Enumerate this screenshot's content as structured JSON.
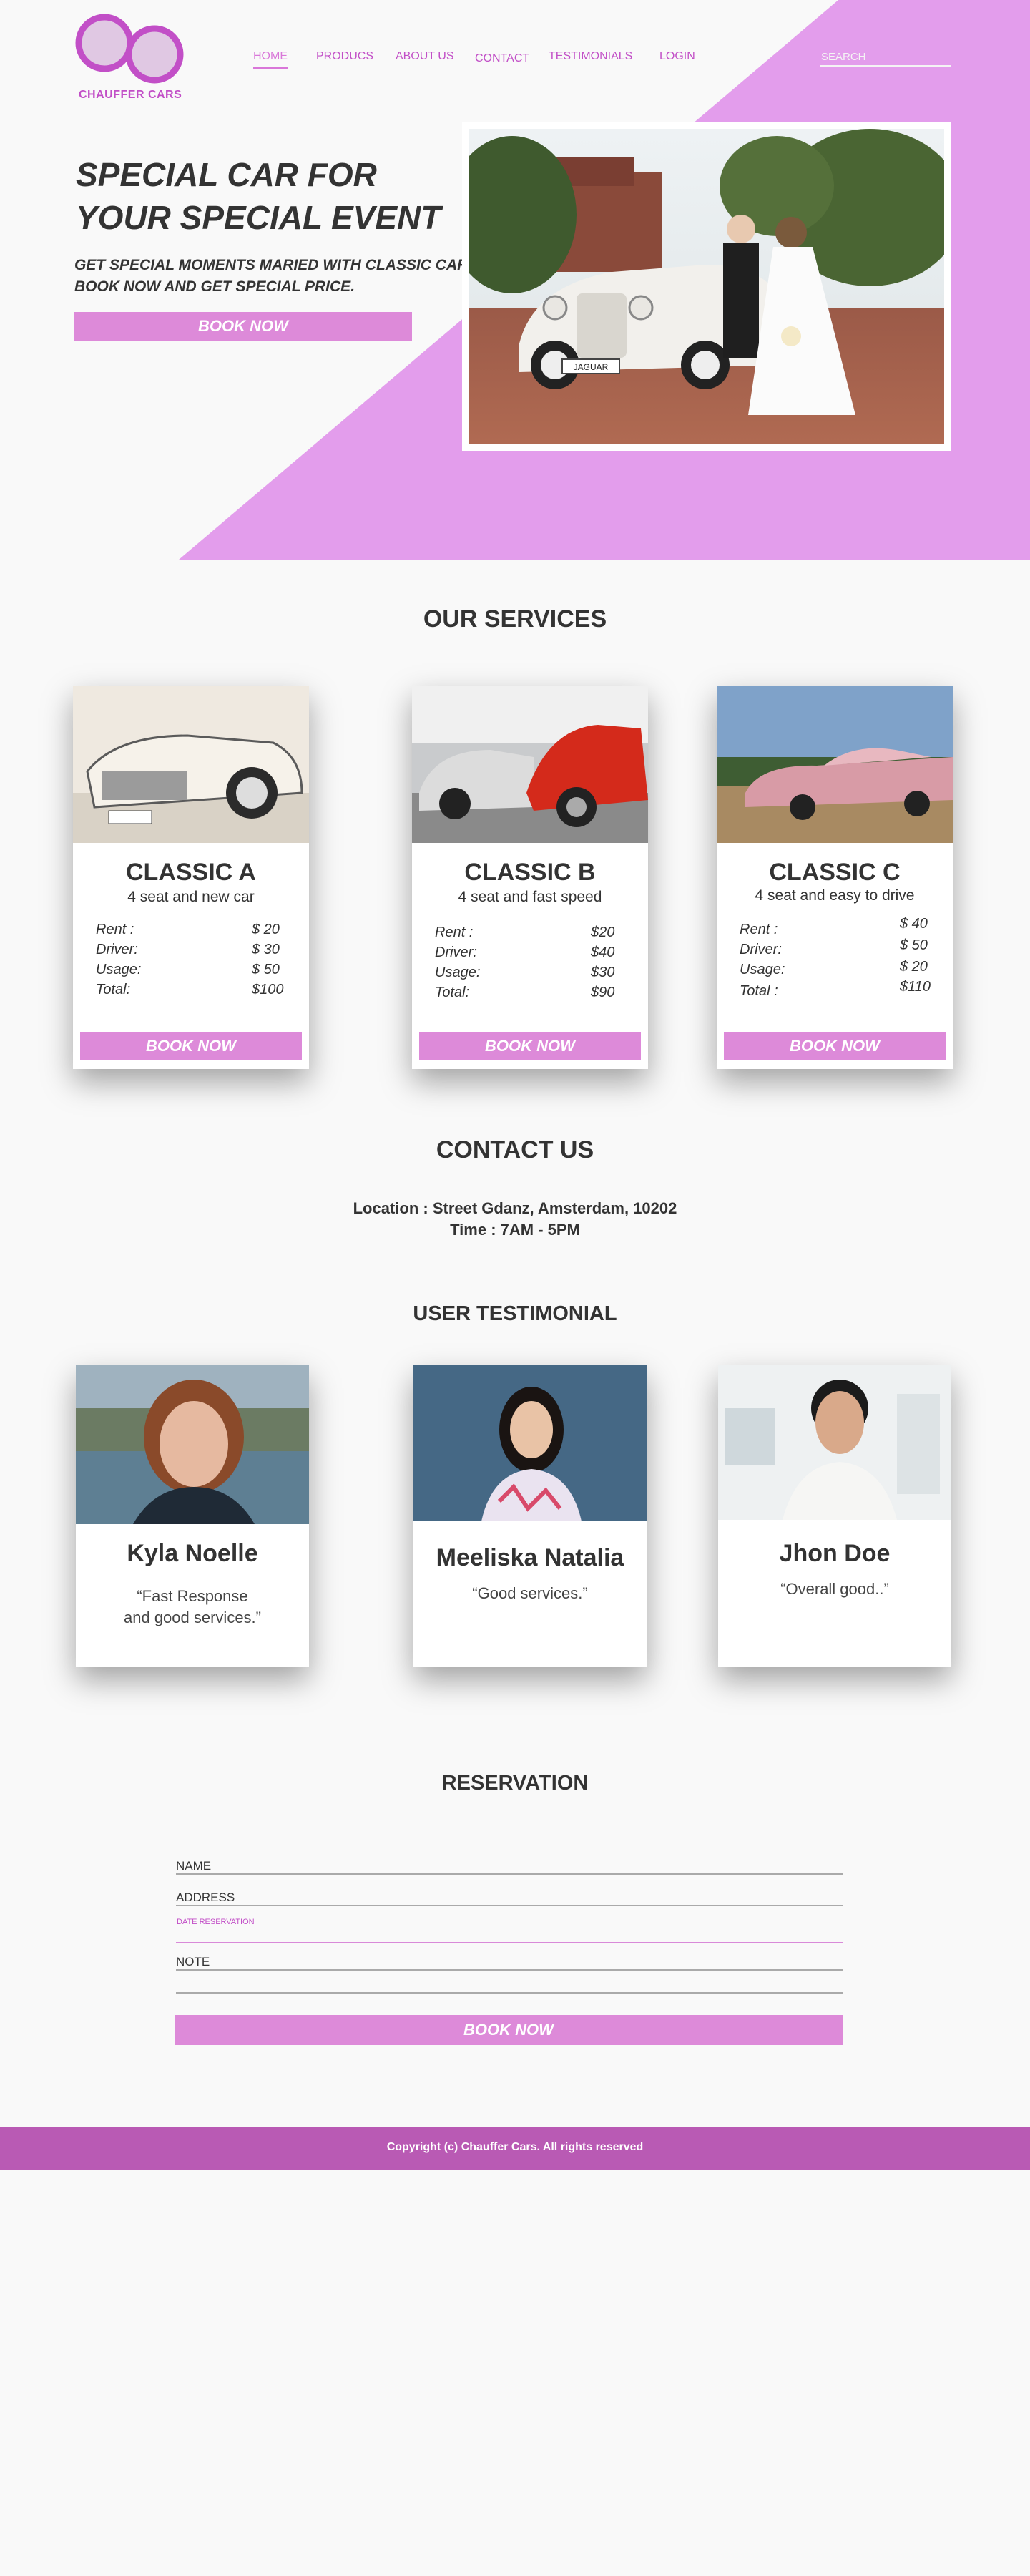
{
  "brand": {
    "name": "CHAUFFER CARS",
    "accent": "#e39dec",
    "accent_dark": "#c24fc7",
    "button": "#dd8ad9",
    "footer": "#b95ab4"
  },
  "nav": {
    "items": [
      {
        "label": "HOME",
        "active": true
      },
      {
        "label": "PRODUCS",
        "active": false
      },
      {
        "label": "ABOUT US",
        "active": false
      },
      {
        "label": "CONTACT",
        "active": false
      },
      {
        "label": "TESTIMONIALS",
        "active": false
      },
      {
        "label": "LOGIN",
        "active": false
      }
    ],
    "search_placeholder": "SEARCH"
  },
  "hero": {
    "title": "SPECIAL CAR FOR YOUR SPECIAL EVENT",
    "subtitle": "GET SPECIAL MOMENTS MARIED WITH CLASSIC CAR. BOOK NOW AND GET SPECIAL PRICE.",
    "button": "BOOK NOW",
    "plate": "JAGUAR"
  },
  "services": {
    "title": "OUR SERVICES",
    "labels": {
      "rent": "Rent  :",
      "driver": "Driver:",
      "usage": "Usage:",
      "total": "Total:",
      "total_c": "Total :"
    },
    "cards": [
      {
        "name": "CLASSIC A",
        "desc": "4 seat and new car",
        "rent": "$  20",
        "driver": "$  30",
        "usage": "$  50",
        "total": "$100",
        "button": "BOOK NOW"
      },
      {
        "name": "CLASSIC  B",
        "desc": "4 seat and fast speed",
        "rent": "$20",
        "driver": "$40",
        "usage": "$30",
        "total": "$90",
        "button": "BOOK NOW"
      },
      {
        "name": "CLASSIC C",
        "desc": "4 seat and easy to drive",
        "rent": "$  40",
        "driver": "$  50",
        "usage": "$  20",
        "total": "$110",
        "button": "BOOK NOW"
      }
    ]
  },
  "contact": {
    "title": "CONTACT US",
    "location": "Location :  Street Gdanz, Amsterdam, 10202",
    "time": "Time :  7AM - 5PM"
  },
  "testimonials": {
    "title": "USER TESTIMONIAL",
    "items": [
      {
        "name": "Kyla Noelle",
        "quote_1": "“Fast Response",
        "quote_2": "and good services.”"
      },
      {
        "name": "Meeliska Natalia",
        "quote_1": "“Good services.”",
        "quote_2": ""
      },
      {
        "name": "Jhon Doe",
        "quote_1": "“Overall good..”",
        "quote_2": ""
      }
    ]
  },
  "reservation": {
    "title": "RESERVATION",
    "name_label": "NAME",
    "address_label": "ADDRESS",
    "date_label": "DATE RESERVATION",
    "note_label": "NOTE",
    "button": "BOOK NOW"
  },
  "footer": {
    "text": "Copyright (c) Chauffer Cars. All rights reserved"
  }
}
